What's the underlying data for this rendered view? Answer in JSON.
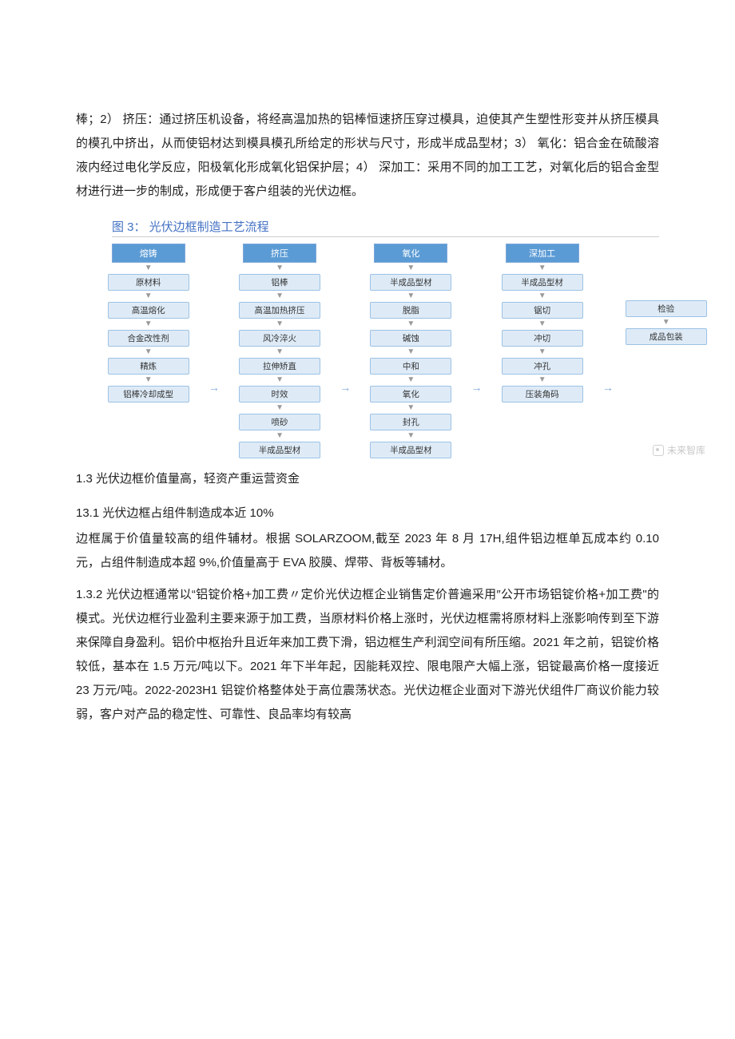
{
  "intro_paragraph": "棒；2） 挤压：通过挤压机设备，将经高温加热的铝棒恒速挤压穿过模具，迫使其产生塑性形变并从挤压模具的模孔中挤出，从而使铝材达到模具模孔所给定的形状与尺寸，形成半成品型材；3） 氧化：铝合金在硫酸溶液内经过电化学反应，阳极氧化形成氧化铝保护层；4） 深加工：采用不同的加工工艺，对氧化后的铝合金型材进行进一步的制成，形成便于客户组装的光伏边框。",
  "figure_caption": "图 3：  光伏边框制造工艺流程",
  "flowchart": {
    "columns": [
      {
        "header": "熔铸",
        "steps": [
          "原材料",
          "高温熔化",
          "合金改性剂",
          "精炼",
          "铝棒冷却成型"
        ]
      },
      {
        "header": "挤压",
        "steps": [
          "铝棒",
          "高温加热挤压",
          "风冷淬火",
          "拉伸矫直",
          "时效",
          "喷砂",
          "半成品型材"
        ]
      },
      {
        "header": "氧化",
        "steps": [
          "半成品型材",
          "脱脂",
          "碱蚀",
          "中和",
          "氧化",
          "封孔",
          "半成品型材"
        ]
      },
      {
        "header": "深加工",
        "steps": [
          "半成品型材",
          "锯切",
          "冲切",
          "冲孔",
          "压装角码"
        ]
      },
      {
        "header": "",
        "steps": [
          "检验",
          "成品包装"
        ]
      }
    ],
    "watermark": "未来智库"
  },
  "section_1_3": "1.3   光伏边框价值量高，轻资产重运营资金",
  "section_1_3_1": "13.1 光伏边框占组件制造成本近 10%",
  "paragraph_1_3_1": "边框属于价值量较高的组件辅材。根据 SOLARZOOM,截至 2023 年 8 月 17H,组件铝边框单瓦成本约 0.10 元，占组件制造成本超 9%,价值量高于 EVA 胶膜、焊带、背板等辅材。",
  "section_1_3_2": "1.3.2 光伏边框通常以“铝锭价格+加工费〃定价光伏边框企业销售定价普遍采用″公开市场铝锭价格+加工费\"的模式。光伏边框行业盈利主要来源于加工费，当原材料价格上涨时，光伏边框需将原材料上涨影响传到至下游来保障自身盈利。铝价中枢抬升且近年来加工费下滑，铝边框生产利润空间有所压缩。2021 年之前，铝锭价格较低，基本在 1.5 万元/吨以下。2021 年下半年起，因能耗双控、限电限产大幅上涨，铝锭最高价格一度接近 23 万元/吨。2022-2023H1 铝锭价格整体处于高位震荡状态。光伏边框企业面对下游光伏组件厂商议价能力较弱，客户对产品的稳定性、可靠性、良品率均有较高"
}
